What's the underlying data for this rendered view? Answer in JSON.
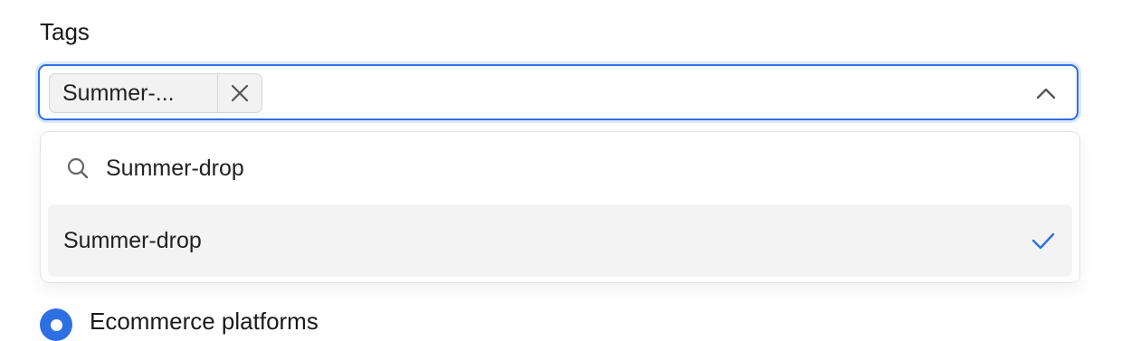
{
  "field": {
    "label": "Tags"
  },
  "selected_chip": {
    "label": "Summer-..."
  },
  "icons": {
    "chip_remove": "close-icon",
    "toggle": "chevron-up-icon",
    "search": "search-icon",
    "selected": "check-icon"
  },
  "dropdown": {
    "search_value": "Summer-drop",
    "options": [
      {
        "label": "Summer-drop",
        "selected": true
      }
    ]
  },
  "radio": {
    "label": "Ecommerce platforms",
    "checked": true
  },
  "colors": {
    "accent": "#2f6fe4",
    "focus_ring": "#dbe7fb",
    "chip_bg": "#f2f2f2",
    "option_hover": "#f3f3f3"
  }
}
